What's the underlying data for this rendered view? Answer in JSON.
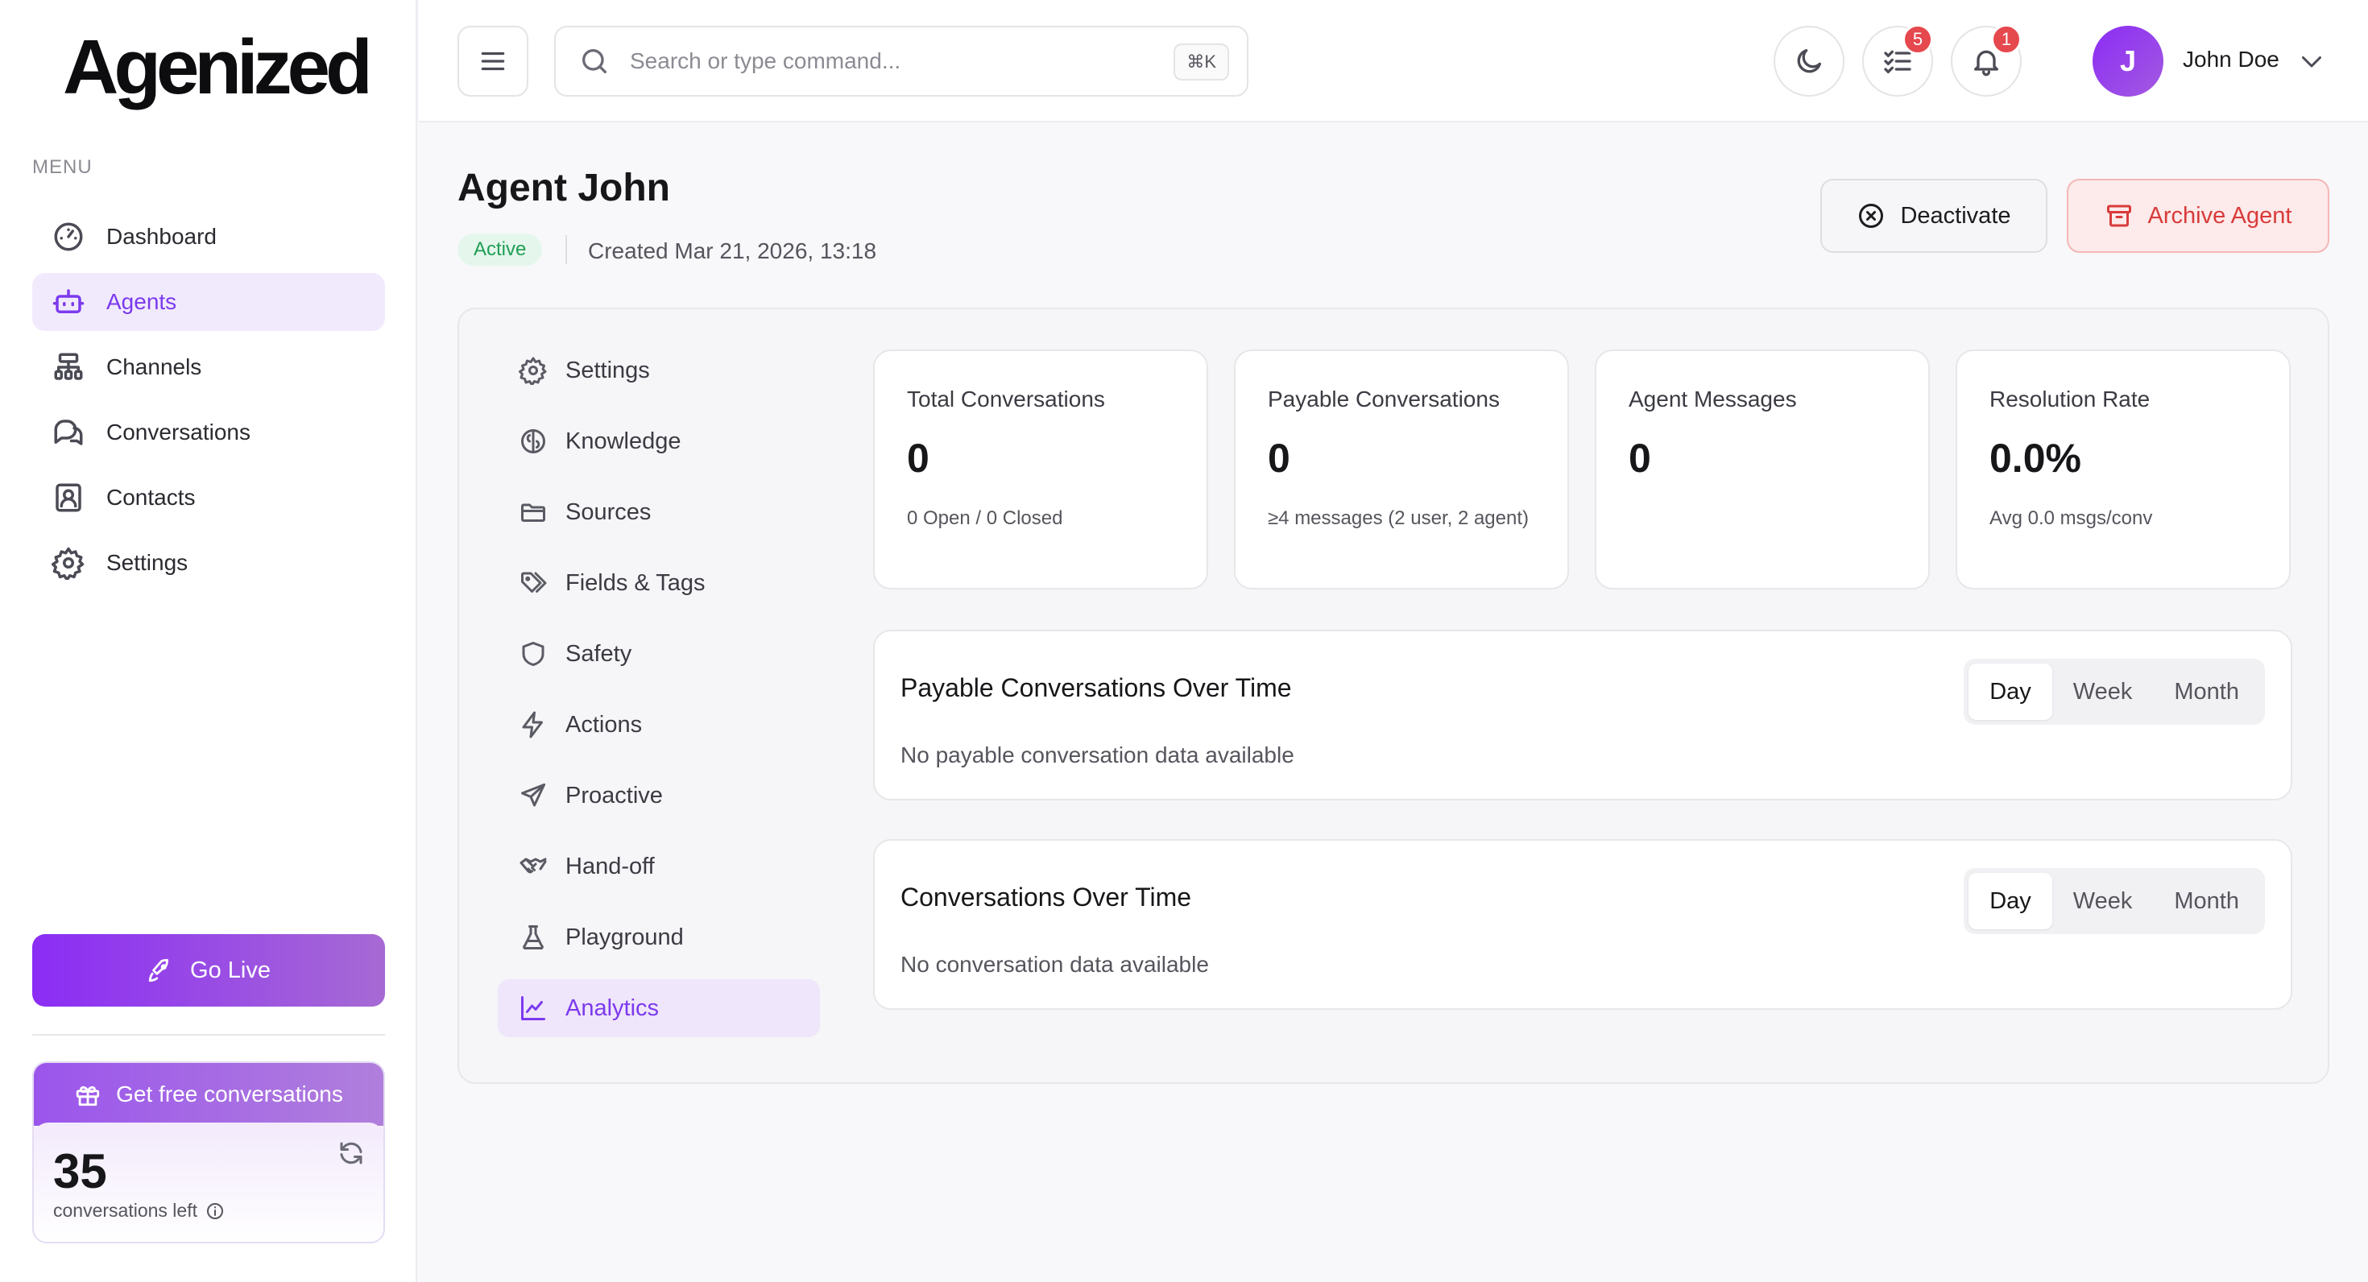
{
  "sidebar": {
    "logo": "Agenized",
    "menu_title": "MENU",
    "items": [
      {
        "label": "Dashboard",
        "icon": "gauge-icon"
      },
      {
        "label": "Agents",
        "icon": "bot-icon"
      },
      {
        "label": "Channels",
        "icon": "network-icon"
      },
      {
        "label": "Conversations",
        "icon": "chat-icon"
      },
      {
        "label": "Contacts",
        "icon": "contact-icon"
      },
      {
        "label": "Settings",
        "icon": "gear-icon"
      }
    ],
    "active_item": "Agents",
    "go_live_label": "Go Live",
    "promo": {
      "title": "Get free conversations",
      "count": "35",
      "count_label": "conversations left"
    }
  },
  "topbar": {
    "search_placeholder": "Search or type command...",
    "shortcut": "⌘K",
    "tasks_badge": "5",
    "notifications_badge": "1",
    "avatar_initial": "J",
    "user_name": "John Doe"
  },
  "page": {
    "title": "Agent John",
    "status": "Active",
    "created": "Created Mar 21, 2026, 13:18",
    "deactivate_label": "Deactivate",
    "archive_label": "Archive Agent"
  },
  "subnav": {
    "items": [
      {
        "label": "Settings",
        "icon": "gear-icon"
      },
      {
        "label": "Knowledge",
        "icon": "brain-icon"
      },
      {
        "label": "Sources",
        "icon": "folder-icon"
      },
      {
        "label": "Fields & Tags",
        "icon": "tags-icon"
      },
      {
        "label": "Safety",
        "icon": "shield-icon"
      },
      {
        "label": "Actions",
        "icon": "bolt-icon"
      },
      {
        "label": "Proactive",
        "icon": "send-icon"
      },
      {
        "label": "Hand-off",
        "icon": "handshake-icon"
      },
      {
        "label": "Playground",
        "icon": "flask-icon"
      },
      {
        "label": "Analytics",
        "icon": "chart-line-icon"
      }
    ],
    "active_item": "Analytics"
  },
  "stats": [
    {
      "label": "Total Conversations",
      "value": "0",
      "sub": "0 Open / 0 Closed"
    },
    {
      "label": "Payable Conversations",
      "value": "0",
      "sub": "≥4 messages (2 user, 2 agent)"
    },
    {
      "label": "Agent Messages",
      "value": "0",
      "sub": ""
    },
    {
      "label": "Resolution Rate",
      "value": "0.0%",
      "sub": "Avg 0.0 msgs/conv"
    }
  ],
  "charts": [
    {
      "title": "Payable Conversations Over Time",
      "empty": "No payable conversation data available",
      "ranges": [
        "Day",
        "Week",
        "Month"
      ],
      "active": "Day"
    },
    {
      "title": "Conversations Over Time",
      "empty": "No conversation data available",
      "ranges": [
        "Day",
        "Week",
        "Month"
      ],
      "active": "Day"
    }
  ],
  "colors": {
    "accent": "#7c3aed",
    "active_badge_bg": "#e5f7ec",
    "active_badge_text": "#1f9d55",
    "danger": "#d93b3b",
    "badge_red": "#e5484d"
  }
}
